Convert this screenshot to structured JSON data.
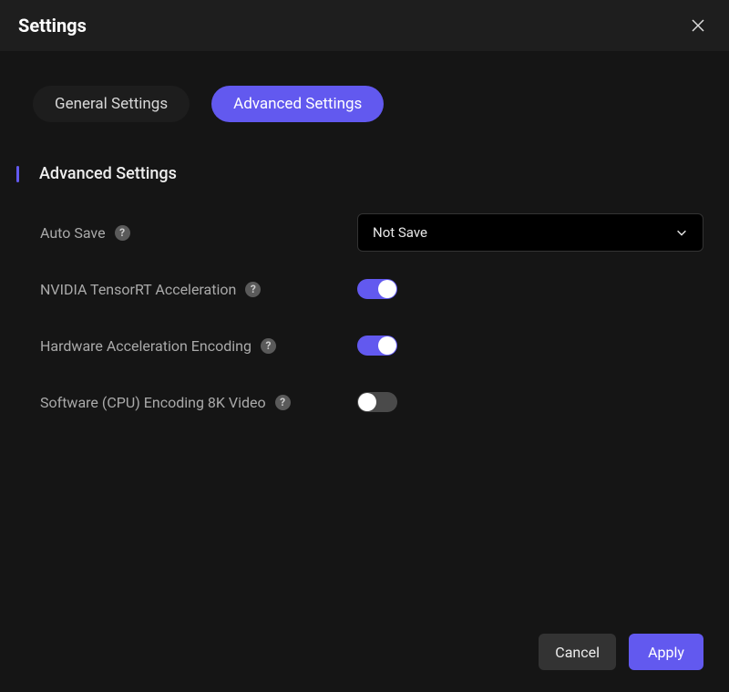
{
  "title": "Settings",
  "tabs": {
    "general": "General Settings",
    "advanced": "Advanced Settings"
  },
  "section": {
    "heading": "Advanced Settings"
  },
  "rows": {
    "autosave": {
      "label": "Auto Save",
      "value": "Not Save"
    },
    "tensorrt": {
      "label": "NVIDIA TensorRT Acceleration",
      "on": true
    },
    "hwenc": {
      "label": "Hardware Acceleration Encoding",
      "on": true
    },
    "cpu8k": {
      "label": "Software (CPU) Encoding 8K Video",
      "on": false
    }
  },
  "buttons": {
    "cancel": "Cancel",
    "apply": "Apply"
  },
  "help_glyph": "?"
}
